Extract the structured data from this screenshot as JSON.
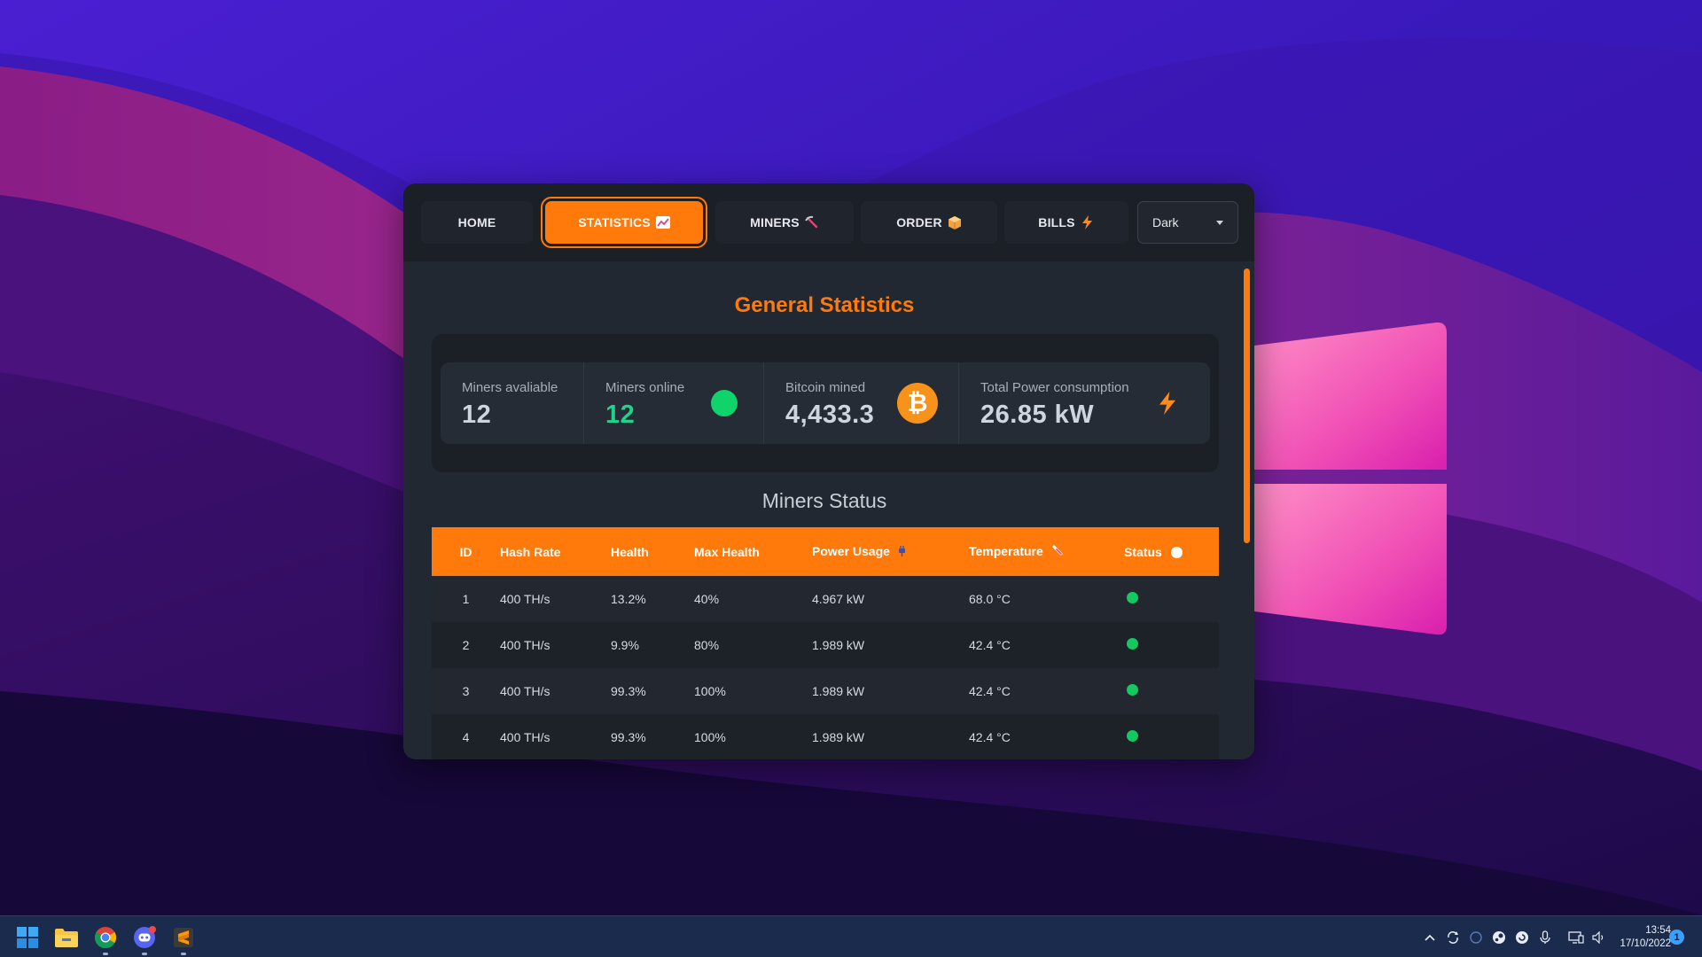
{
  "nav": {
    "tabs": [
      {
        "label": "HOME",
        "icon": ""
      },
      {
        "label": "STATISTICS",
        "icon": "chart-icon"
      },
      {
        "label": "MINERS",
        "icon": "pickaxe-icon"
      },
      {
        "label": "ORDER",
        "icon": "package-icon"
      },
      {
        "label": "BILLS",
        "icon": "lightning-icon"
      }
    ],
    "active_tab": "STATISTICS",
    "theme_value": "Dark"
  },
  "general": {
    "title": "General Statistics",
    "stats": [
      {
        "label": "Miners avaliable",
        "value": "12"
      },
      {
        "label": "Miners online",
        "value": "12",
        "icon": "online-dot-icon"
      },
      {
        "label": "Bitcoin mined",
        "value": "4,433.3",
        "icon": "bitcoin-icon"
      },
      {
        "label": "Total Power consumption",
        "value": "26.85 kW",
        "icon": "lightning-icon"
      }
    ]
  },
  "miners_status": {
    "title": "Miners Status",
    "columns": [
      "ID",
      "Hash Rate",
      "Health",
      "Max Health",
      "Power Usage",
      "Temperature",
      "Status"
    ],
    "rows": [
      {
        "id": "1",
        "hash_rate": "400 TH/s",
        "health": "13.2%",
        "max_health": "40%",
        "power": "4.967 kW",
        "temperature": "68.0 °C",
        "status": "online"
      },
      {
        "id": "2",
        "hash_rate": "400 TH/s",
        "health": "9.9%",
        "max_health": "80%",
        "power": "1.989 kW",
        "temperature": "42.4 °C",
        "status": "online"
      },
      {
        "id": "3",
        "hash_rate": "400 TH/s",
        "health": "99.3%",
        "max_health": "100%",
        "power": "1.989 kW",
        "temperature": "42.4 °C",
        "status": "online"
      },
      {
        "id": "4",
        "hash_rate": "400 TH/s",
        "health": "99.3%",
        "max_health": "100%",
        "power": "1.989 kW",
        "temperature": "42.4 °C",
        "status": "online"
      }
    ]
  },
  "taskbar": {
    "apps": [
      "start-icon",
      "file-explorer-icon",
      "chrome-icon",
      "discord-icon",
      "sublime-text-icon"
    ],
    "time": "13:54",
    "date": "17/10/2022",
    "notification_count": "1"
  },
  "colors": {
    "accent": "#ff7a0a",
    "online": "#11c95f",
    "bitcoin": "#f7931a"
  }
}
